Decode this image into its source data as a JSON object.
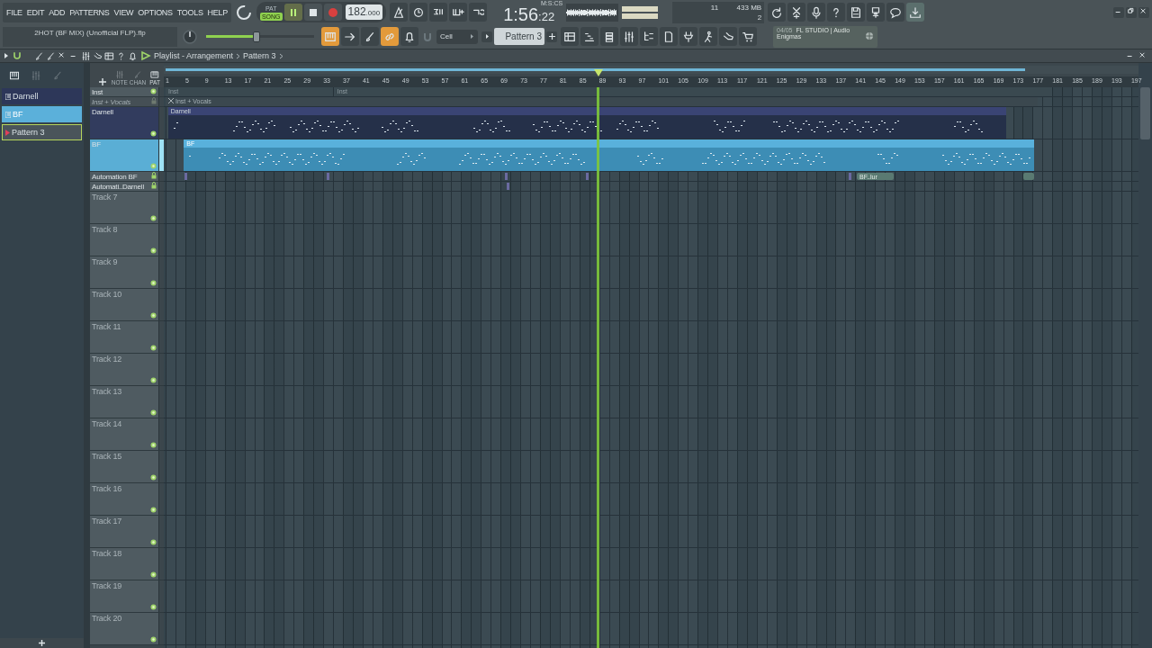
{
  "menu": [
    "FILE",
    "EDIT",
    "ADD",
    "PATTERNS",
    "VIEW",
    "OPTIONS",
    "TOOLS",
    "HELP"
  ],
  "transport": {
    "modes": [
      {
        "label": "PAT",
        "selected": false
      },
      {
        "label": "SONG",
        "selected": true
      }
    ],
    "playing": true,
    "recording": false,
    "tempo": "182",
    "tempo_fraction": ".000"
  },
  "clock": {
    "time": "1:56",
    "centiseconds": ":22",
    "unit": "M:S:CS"
  },
  "monitor": {
    "voices": "11",
    "memory": "433 MB",
    "polyphony": "2"
  },
  "project_name": "2HOT (BF MIX) (Unofficial FLP).flp",
  "master_volume": {
    "level": 0.47
  },
  "view_buttons": [
    {
      "on": true
    },
    {
      "on": false
    },
    {
      "on": false
    },
    {
      "on": true
    },
    {
      "on": false
    }
  ],
  "snap": "Cell",
  "pattern_selector": "Pattern 3",
  "news": {
    "date": "04/05",
    "title": "FL STUDIO | Audio",
    "subtitle": "Enigmas"
  },
  "playlist": {
    "title": "Playlist - Arrangement",
    "pattern": "Pattern 3"
  },
  "patterns": [
    {
      "name": "Darnell",
      "selected": false,
      "current": false
    },
    {
      "name": "BF",
      "selected": true,
      "current": false
    },
    {
      "name": "Pattern 3",
      "selected": false,
      "current": true
    }
  ],
  "track_tools": [
    {
      "label": "NOTE",
      "selected": false
    },
    {
      "label": "CHAN",
      "selected": false
    },
    {
      "label": "PAT",
      "selected": true
    }
  ],
  "ruler": [
    "1",
    "5",
    "9",
    "13",
    "17",
    "21",
    "25",
    "29",
    "33",
    "37",
    "41",
    "45",
    "49",
    "53",
    "57",
    "61",
    "65",
    "69",
    "73",
    "77",
    "81",
    "85",
    "89",
    "93",
    "97",
    "101",
    "105",
    "109",
    "113",
    "117",
    "121",
    "125",
    "129",
    "133",
    "137",
    "141",
    "145",
    "149",
    "153",
    "157",
    "161",
    "165",
    "169",
    "173",
    "177",
    "181",
    "185",
    "189",
    "193",
    "197"
  ],
  "tracks": [
    {
      "name": "Inst",
      "kind": "thin",
      "selected": false,
      "muted": false,
      "locked": false,
      "clips": [
        {
          "label": "Inst"
        },
        {
          "label": "Inst"
        }
      ]
    },
    {
      "name": "Inst + Vocals",
      "kind": "thin",
      "selected": false,
      "muted": true,
      "locked": true,
      "clips": [
        {
          "label": "Inst + Vocals"
        }
      ]
    },
    {
      "name": "Darnell",
      "kind": "tall",
      "selected": false,
      "muted": false,
      "locked": false,
      "clips": [
        {
          "label": "Darnell"
        }
      ]
    },
    {
      "name": "BF",
      "kind": "tall",
      "selected": true,
      "muted": false,
      "locked": false,
      "clips": [
        {
          "label": "BF"
        }
      ]
    },
    {
      "name": "Automation BF",
      "kind": "thin",
      "selected": false,
      "muted": false,
      "locked": true,
      "clips": [
        {
          "label": "BF..lur"
        }
      ]
    },
    {
      "name": "Automati..Darnell",
      "kind": "thin",
      "selected": false,
      "muted": false,
      "locked": true
    },
    {
      "name": "Track 7",
      "kind": "empty",
      "selected": false,
      "muted": false,
      "locked": false
    },
    {
      "name": "Track 8",
      "kind": "empty",
      "selected": false,
      "muted": false,
      "locked": false
    },
    {
      "name": "Track 9",
      "kind": "empty",
      "selected": false,
      "muted": false,
      "locked": false
    },
    {
      "name": "Track 10",
      "kind": "empty",
      "selected": false,
      "muted": false,
      "locked": false
    },
    {
      "name": "Track 11",
      "kind": "empty",
      "selected": false,
      "muted": false,
      "locked": false
    },
    {
      "name": "Track 12",
      "kind": "empty",
      "selected": false,
      "muted": false,
      "locked": false
    },
    {
      "name": "Track 13",
      "kind": "empty",
      "selected": false,
      "muted": false,
      "locked": false
    },
    {
      "name": "Track 14",
      "kind": "empty",
      "selected": false,
      "muted": false,
      "locked": false
    },
    {
      "name": "Track 15",
      "kind": "empty",
      "selected": false,
      "muted": false,
      "locked": false
    },
    {
      "name": "Track 16",
      "kind": "empty",
      "selected": false,
      "muted": false,
      "locked": false
    },
    {
      "name": "Track 17",
      "kind": "empty",
      "selected": false,
      "muted": false,
      "locked": false
    },
    {
      "name": "Track 18",
      "kind": "empty",
      "selected": false,
      "muted": false,
      "locked": false
    },
    {
      "name": "Track 19",
      "kind": "empty",
      "selected": false,
      "muted": false,
      "locked": false
    },
    {
      "name": "Track 20",
      "kind": "empty",
      "selected": false,
      "muted": false,
      "locked": false
    }
  ]
}
